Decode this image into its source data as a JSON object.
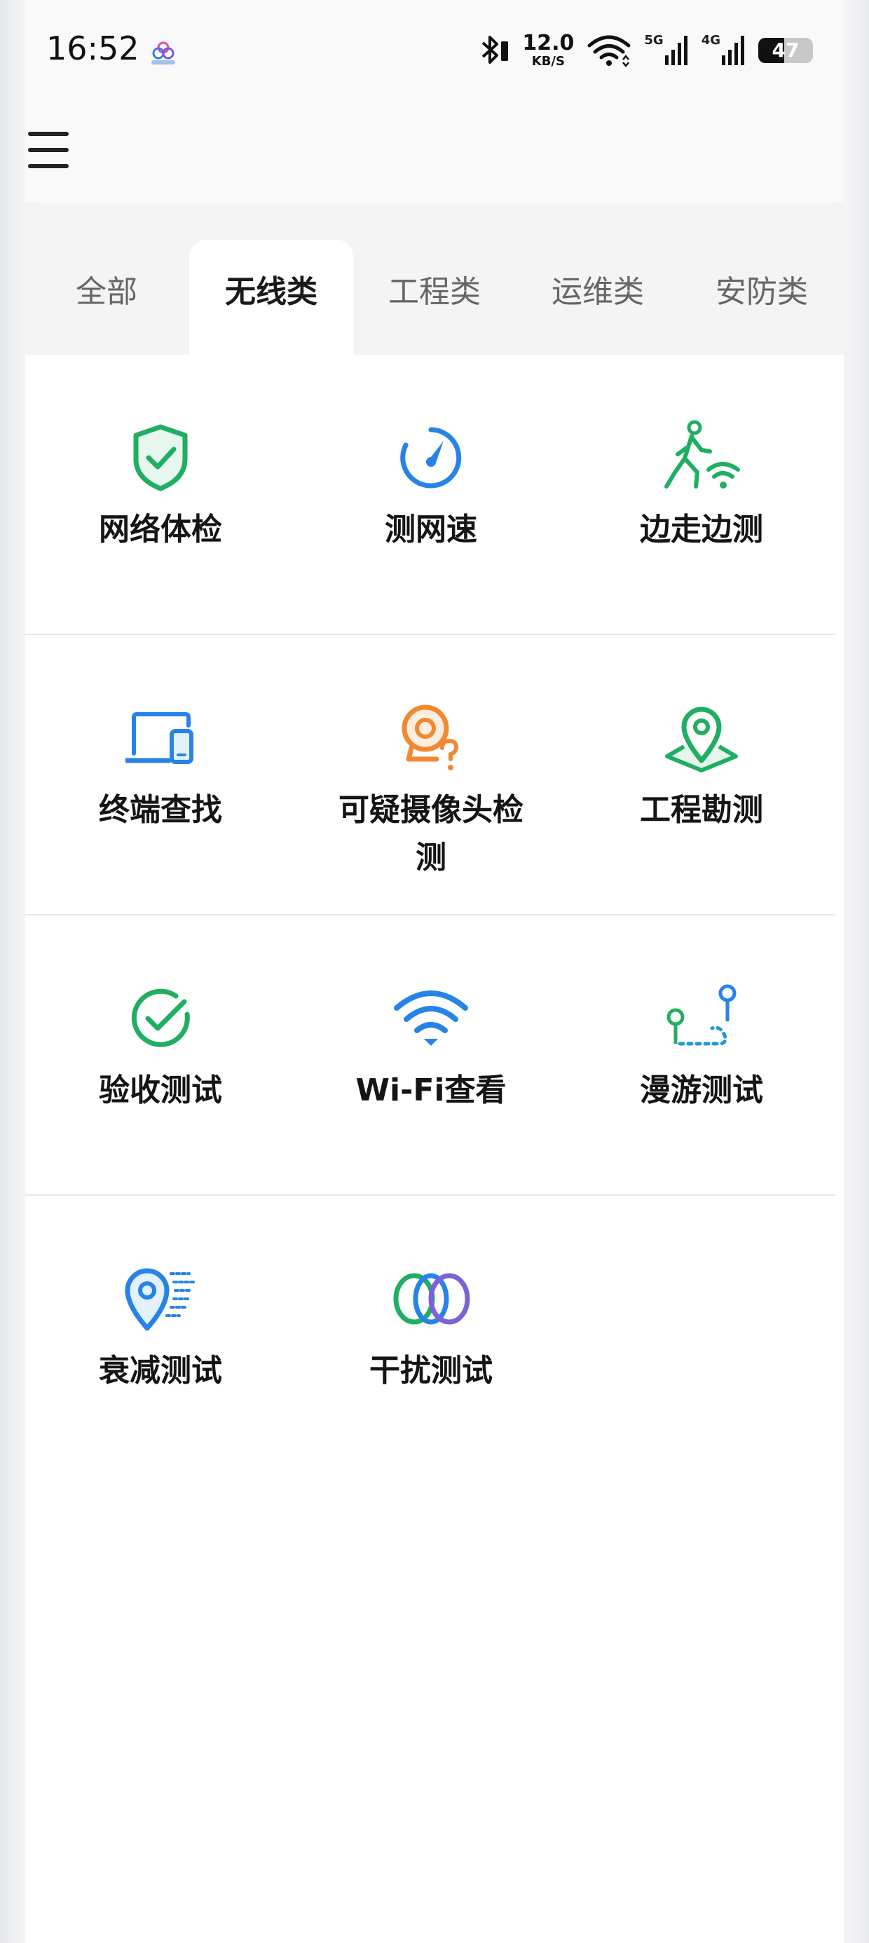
{
  "status_bar": {
    "time": "16:52",
    "app_icon": "multicolor-circles-app-icon",
    "bluetooth_icon": "bluetooth-icon",
    "net_speed_value": "12.0",
    "net_speed_unit": "KB/S",
    "wifi_icon": "wifi-icon",
    "sim1_label": "5G",
    "sim2_label": "4G",
    "battery_level": "47",
    "battery_fraction": 0.47
  },
  "header": {
    "menu_icon": "hamburger-menu-icon"
  },
  "tabs": [
    {
      "label": "全部",
      "active": false
    },
    {
      "label": "无线类",
      "active": true
    },
    {
      "label": "工程类",
      "active": false
    },
    {
      "label": "运维类",
      "active": false
    },
    {
      "label": "安防类",
      "active": false
    }
  ],
  "tools": [
    {
      "label": "网络体检",
      "icon": "shield-check-icon",
      "color": "#1fae62"
    },
    {
      "label": "测网速",
      "icon": "speedometer-icon",
      "color": "#2783e8"
    },
    {
      "label": "边走边测",
      "icon": "walking-wifi-icon",
      "color": "#1fae62"
    },
    {
      "label": "终端查找",
      "icon": "devices-icon",
      "color": "#2783e8"
    },
    {
      "label": "可疑摄像头检测",
      "icon": "camera-question-icon",
      "color": "#f08a32"
    },
    {
      "label": "工程勘测",
      "icon": "map-pin-area-icon",
      "color": "#1fae62"
    },
    {
      "label": "验收测试",
      "icon": "check-circle-icon",
      "color": "#1fae62"
    },
    {
      "label": "Wi-Fi查看",
      "icon": "wifi-signal-icon",
      "color": "#2783e8"
    },
    {
      "label": "漫游测试",
      "icon": "roaming-path-icon",
      "color": "#2098d6"
    },
    {
      "label": "衰减测试",
      "icon": "pin-attenuation-icon",
      "color": "#2783e8"
    },
    {
      "label": "干扰测试",
      "icon": "interference-rings-icon",
      "color": "#7b62d6"
    }
  ]
}
